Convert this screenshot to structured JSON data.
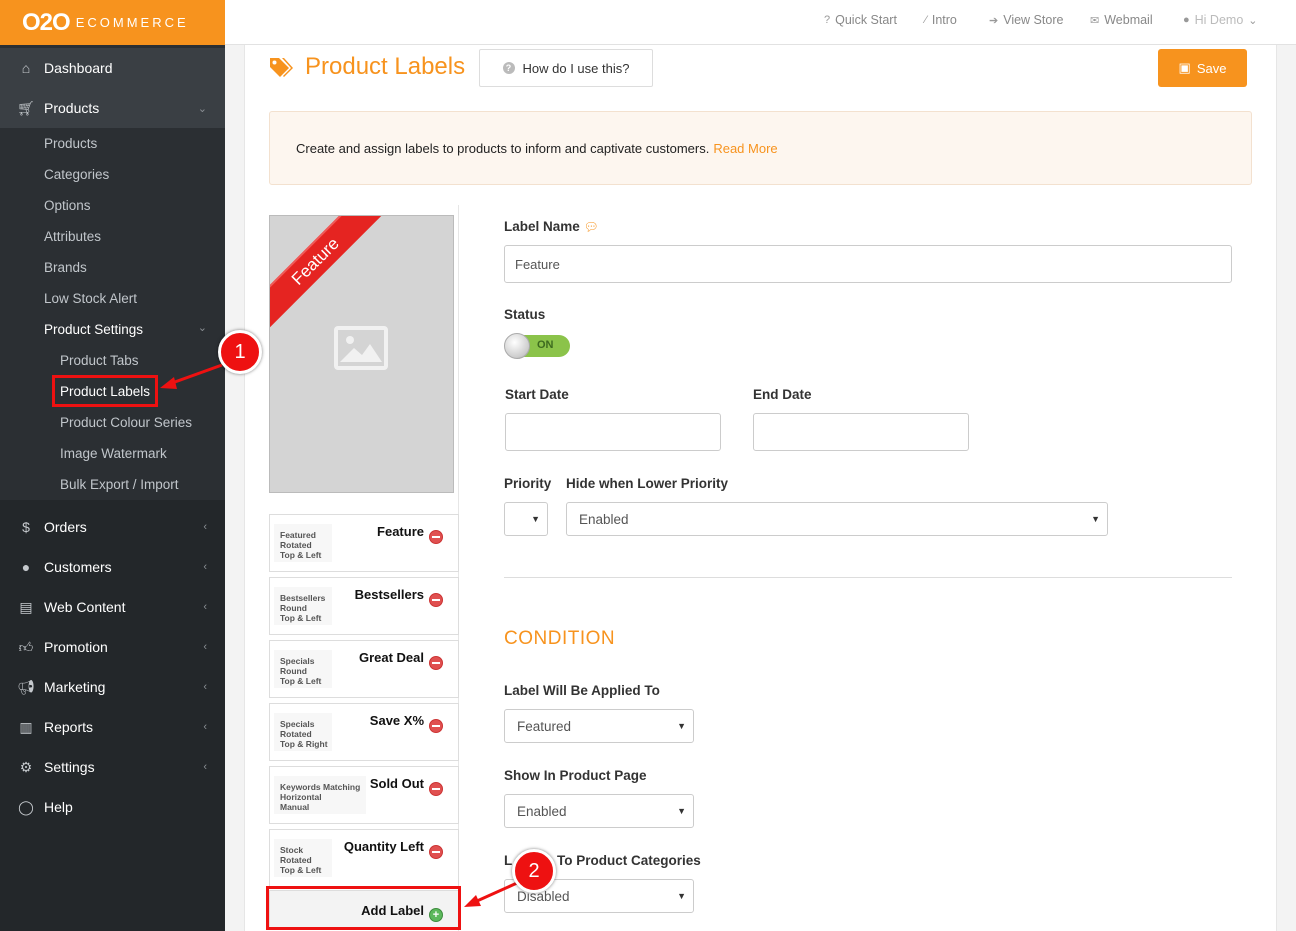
{
  "brand": {
    "logo_main": "O2O",
    "logo_sub": "ECOMMERCE"
  },
  "topnav": [
    {
      "icon": "question-icon",
      "label": "Quick Start"
    },
    {
      "icon": "wand-icon",
      "label": "Intro"
    },
    {
      "icon": "sign-in-icon",
      "label": "View Store"
    },
    {
      "icon": "envelope-icon",
      "label": "Webmail"
    },
    {
      "icon": "user-icon",
      "label": "Hi Demo"
    }
  ],
  "sidebar": {
    "dashboard": "Dashboard",
    "products": "Products",
    "products_sub": [
      "Products",
      "Categories",
      "Options",
      "Attributes",
      "Brands",
      "Low Stock Alert",
      "Product Settings"
    ],
    "settings_sub": [
      "Product Tabs",
      "Product Labels",
      "Product Colour Series",
      "Image Watermark",
      "Bulk Export / Import"
    ],
    "sections": [
      "Orders",
      "Customers",
      "Web Content",
      "Promotion",
      "Marketing",
      "Reports",
      "Settings",
      "Help"
    ]
  },
  "page": {
    "title": "Product Labels",
    "howto": "How do I use this?",
    "save": "Save",
    "info_text": "Create and assign labels to products to inform and captivate customers.",
    "info_link": "Read More"
  },
  "preview": {
    "ribbon_text": "Feature"
  },
  "labels": [
    {
      "meta": [
        "Featured",
        "Rotated",
        "Top & Left"
      ],
      "name": "Feature"
    },
    {
      "meta": [
        "Bestsellers",
        "Round",
        "Top & Left"
      ],
      "name": "Bestsellers"
    },
    {
      "meta": [
        "Specials",
        "Round",
        "Top & Left"
      ],
      "name": "Great Deal"
    },
    {
      "meta": [
        "Specials",
        "Rotated",
        "Top & Right"
      ],
      "name": "Save X%"
    },
    {
      "meta": [
        "Keywords Matching",
        "Horizontal",
        "Manual"
      ],
      "name": "Sold Out"
    },
    {
      "meta": [
        "Stock",
        "Rotated",
        "Top & Left"
      ],
      "name": "Quantity Left"
    }
  ],
  "add_label": "Add Label",
  "form": {
    "label_name_label": "Label Name",
    "label_name_value": "Feature",
    "status_label": "Status",
    "status_value": "ON",
    "start_date_label": "Start Date",
    "end_date_label": "End Date",
    "priority_label": "Priority",
    "hide_lower_label": "Hide when Lower Priority",
    "hide_lower_value": "Enabled",
    "condition_title": "CONDITION",
    "applied_to_label": "Label Will Be Applied To",
    "applied_to_value": "Featured",
    "show_in_page_label": "Show In Product Page",
    "show_in_page_value": "Enabled",
    "categories_label_left": "L",
    "categories_label_right": "To Product Categories",
    "categories_value": "Disabled"
  },
  "annotations": [
    "1",
    "2"
  ],
  "colors": {
    "accent": "#f7931e",
    "sidebar": "#2b2f33",
    "annotation": "#e11111",
    "toggle_on": "#8bc34a"
  }
}
